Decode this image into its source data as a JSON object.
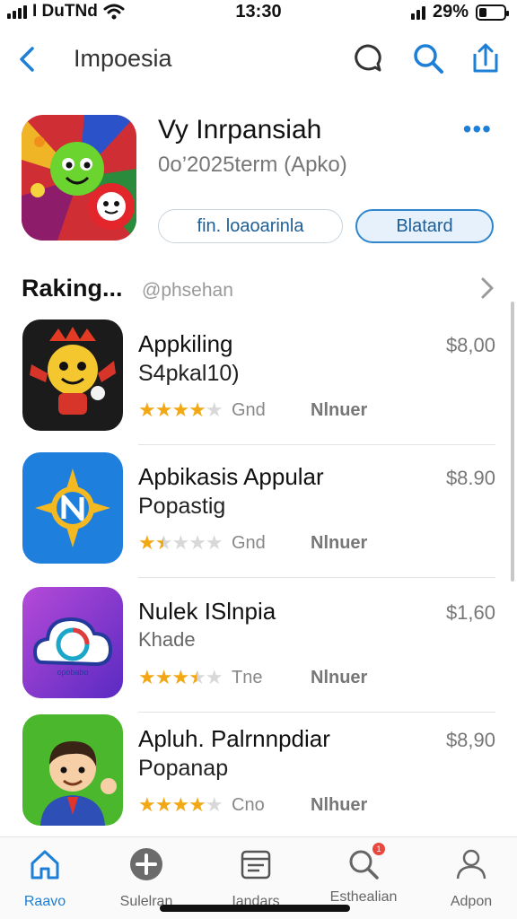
{
  "status_bar": {
    "carrier": "I DuTNd",
    "time": "13:30",
    "battery": "29%"
  },
  "nav": {
    "title": "Impoesia",
    "icons": [
      "back-chevron-icon",
      "chat-bubble-icon",
      "search-icon",
      "share-icon"
    ]
  },
  "app": {
    "name": "Vy Inrpansiah",
    "subtitle": "0o’2025term (Apko)",
    "secondary_button": "fin. loaoarinla",
    "primary_button": "Blatard",
    "more_icon": "ellipsis-icon"
  },
  "section": {
    "title": "Raking...",
    "subtitle": "@phsehan"
  },
  "list": [
    {
      "title": "Appkiling",
      "subtitle": "S4pkal10)",
      "rating": 4,
      "meta": "Gnd",
      "tag": "Nlnuer",
      "price": "$8,00",
      "icon": "emoji-mascot-icon"
    },
    {
      "title": "Apbikasis Appular",
      "subtitle": "Popastig",
      "rating": 1.5,
      "meta": "Gnd",
      "tag": "Nlnuer",
      "price": "$8.90",
      "icon": "compass-n-icon"
    },
    {
      "title": "Nulek ISlnpia",
      "subtitle": "Khade",
      "rating": 3.5,
      "meta": "Tne",
      "tag": "Nlnuer",
      "price": "$1,60",
      "icon": "cloud-badge-icon"
    },
    {
      "title": "Apluh. Palrnnpdiar",
      "subtitle": "Popanap",
      "rating": 4,
      "meta": "Cno",
      "tag": "Nlhuer",
      "price": "$8,90",
      "icon": "cartoon-person-icon"
    }
  ],
  "tabs": [
    {
      "label": "Raavo",
      "icon": "home-icon",
      "active": true
    },
    {
      "label": "Sulelran",
      "icon": "plus-circle-icon",
      "active": false
    },
    {
      "label": "Iandars",
      "icon": "calendar-icon",
      "active": false
    },
    {
      "label": "Esthealian",
      "icon": "search-icon",
      "active": false,
      "badge": "1"
    },
    {
      "label": "Adpon",
      "icon": "person-icon",
      "active": false
    }
  ],
  "colors": {
    "accent": "#1d7fd6",
    "star": "#f2a815",
    "badge": "#e8483d"
  }
}
